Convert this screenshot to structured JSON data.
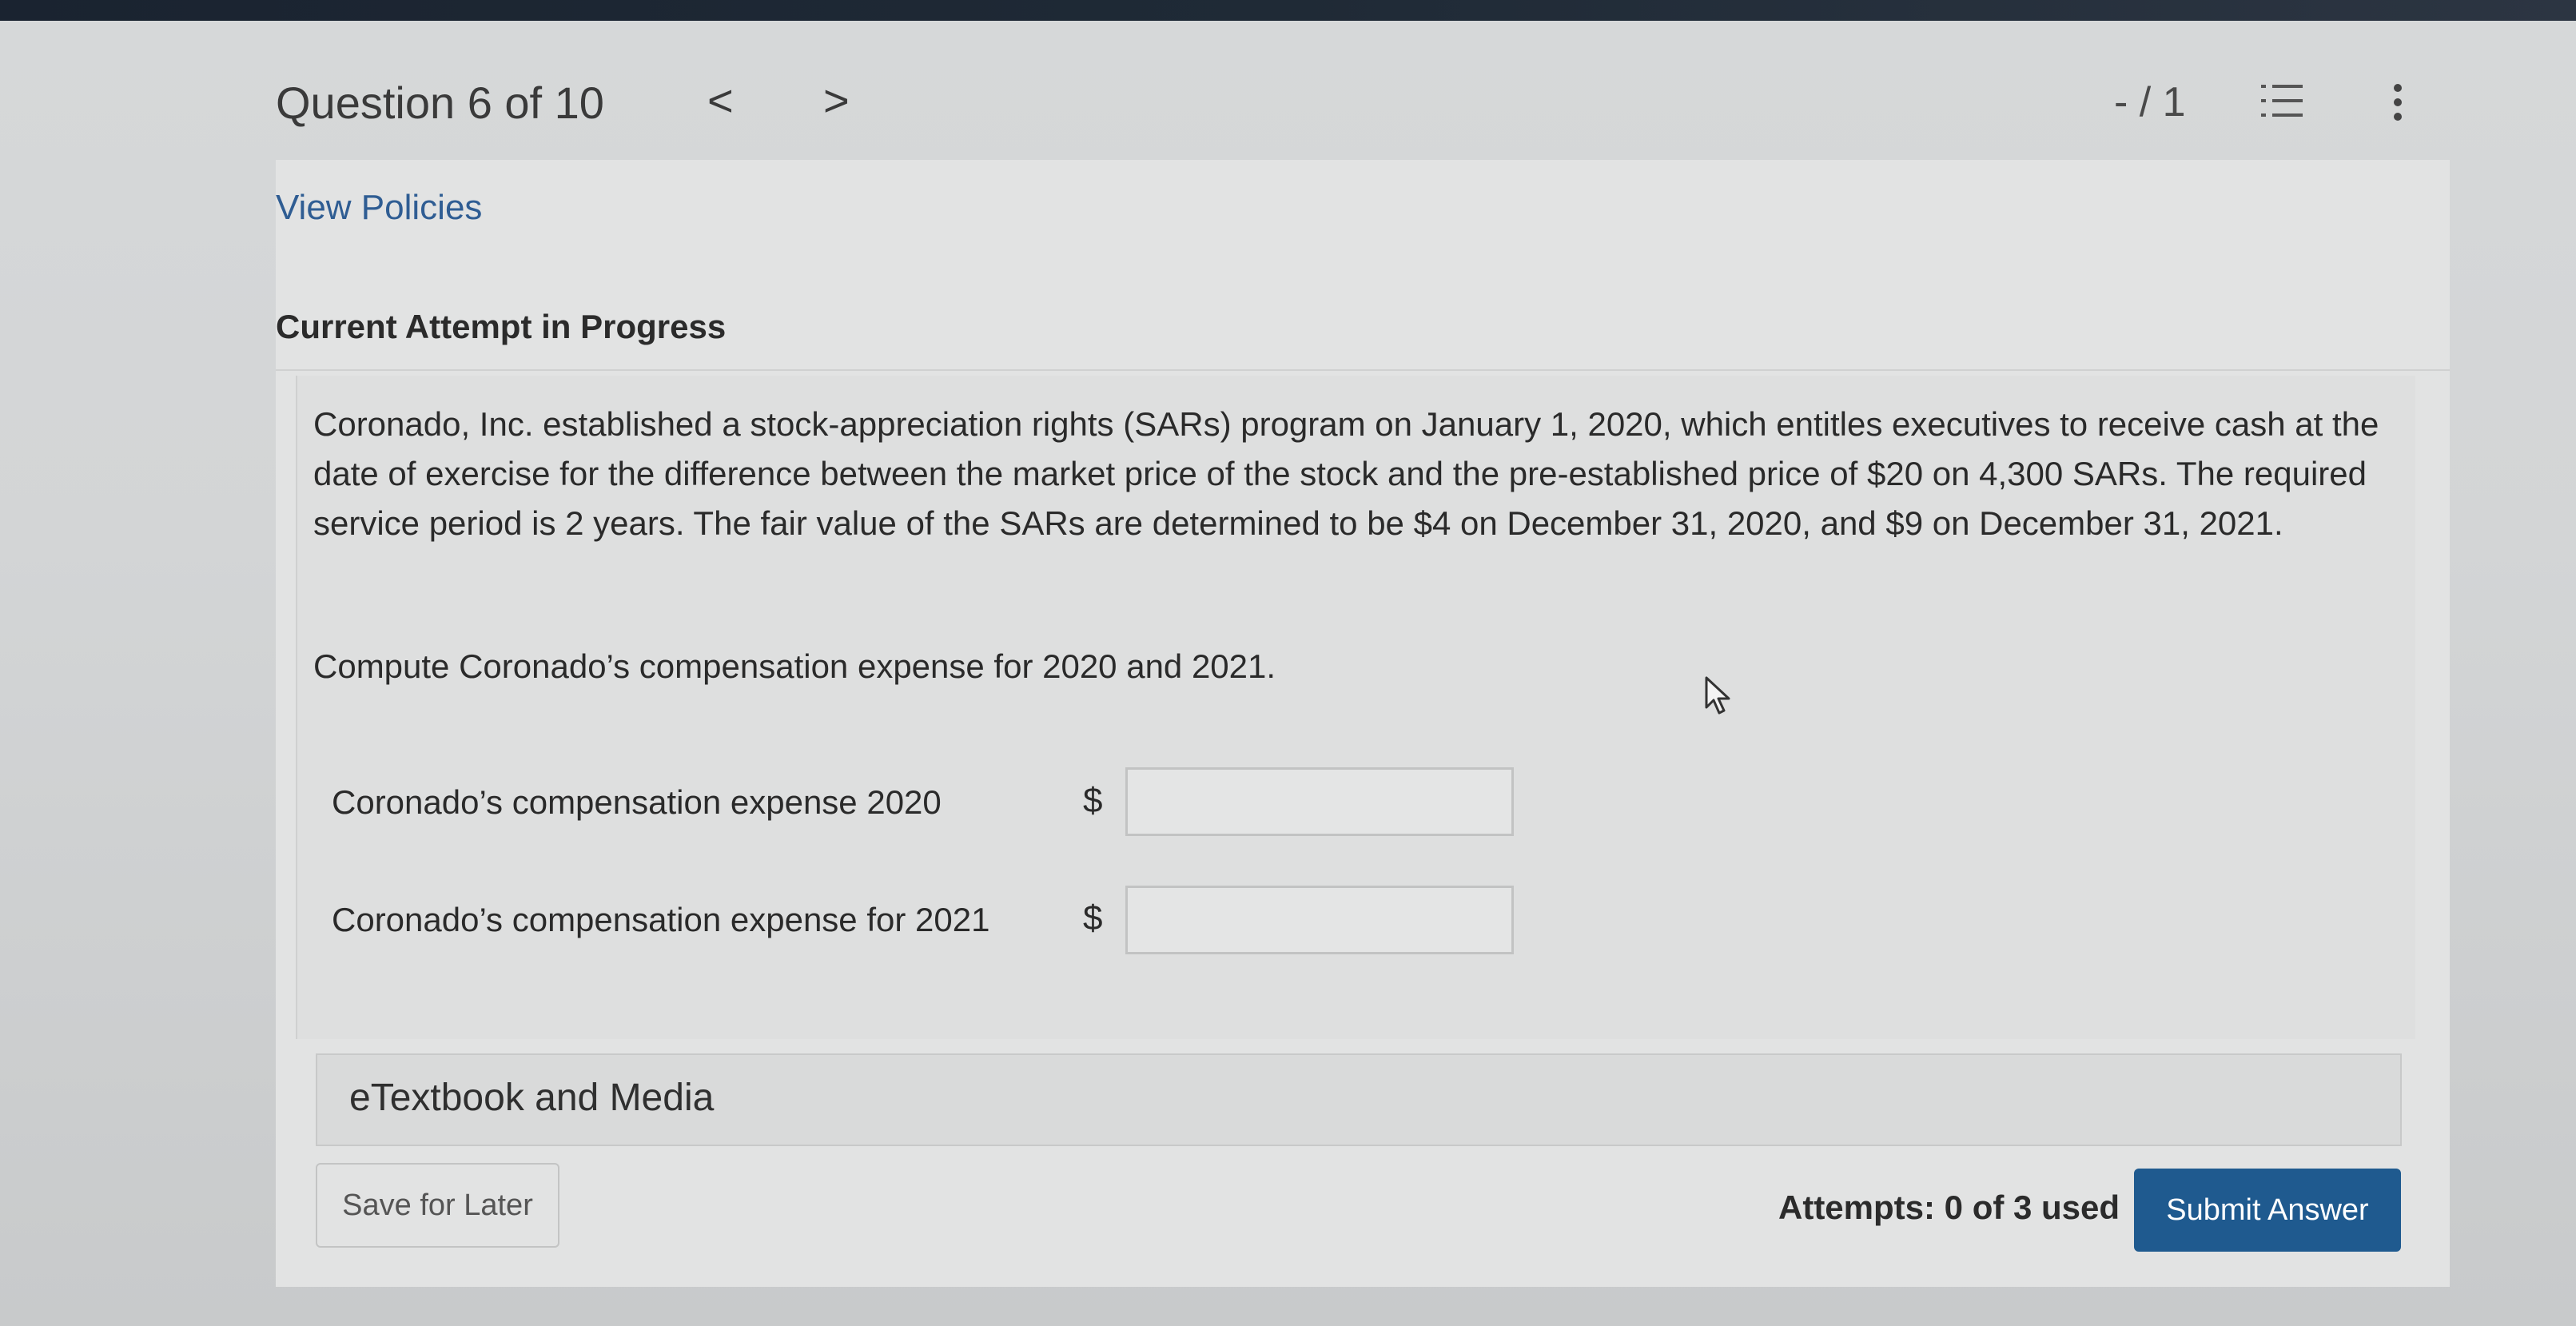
{
  "header": {
    "question_counter": "Question 6 of 10",
    "prev_arrow": "<",
    "next_arrow": ">",
    "score": "- / 1"
  },
  "view_policies": "View Policies",
  "attempt_title": "Current Attempt in Progress",
  "question": {
    "body": "Coronado, Inc. established a stock-appreciation rights (SARs) program on January 1, 2020, which entitles executives to receive cash at the date of exercise for the difference between the market price of the stock and the pre-established price of $20 on 4,300 SARs. The required service period is 2 years. The fair value of the SARs are determined to be $4 on December 31, 2020, and $9 on December 31, 2021.",
    "prompt": "Compute Coronado’s compensation expense for 2020 and 2021."
  },
  "answers": [
    {
      "label": "Coronado’s compensation expense 2020",
      "currency": "$",
      "value": ""
    },
    {
      "label": "Coronado’s compensation expense for 2021",
      "currency": "$",
      "value": ""
    }
  ],
  "etextbook_label": "eTextbook and Media",
  "footer": {
    "save_label": "Save for Later",
    "attempts_text": "Attempts: 0 of 3 used",
    "submit_label": "Submit Answer"
  },
  "colors": {
    "link": "#2f5d93",
    "submit_bg": "#1f5a8f"
  },
  "icons": {
    "list": "numbered-list-icon",
    "menu": "kebab-menu-icon",
    "cursor": "mouse-pointer-icon"
  }
}
